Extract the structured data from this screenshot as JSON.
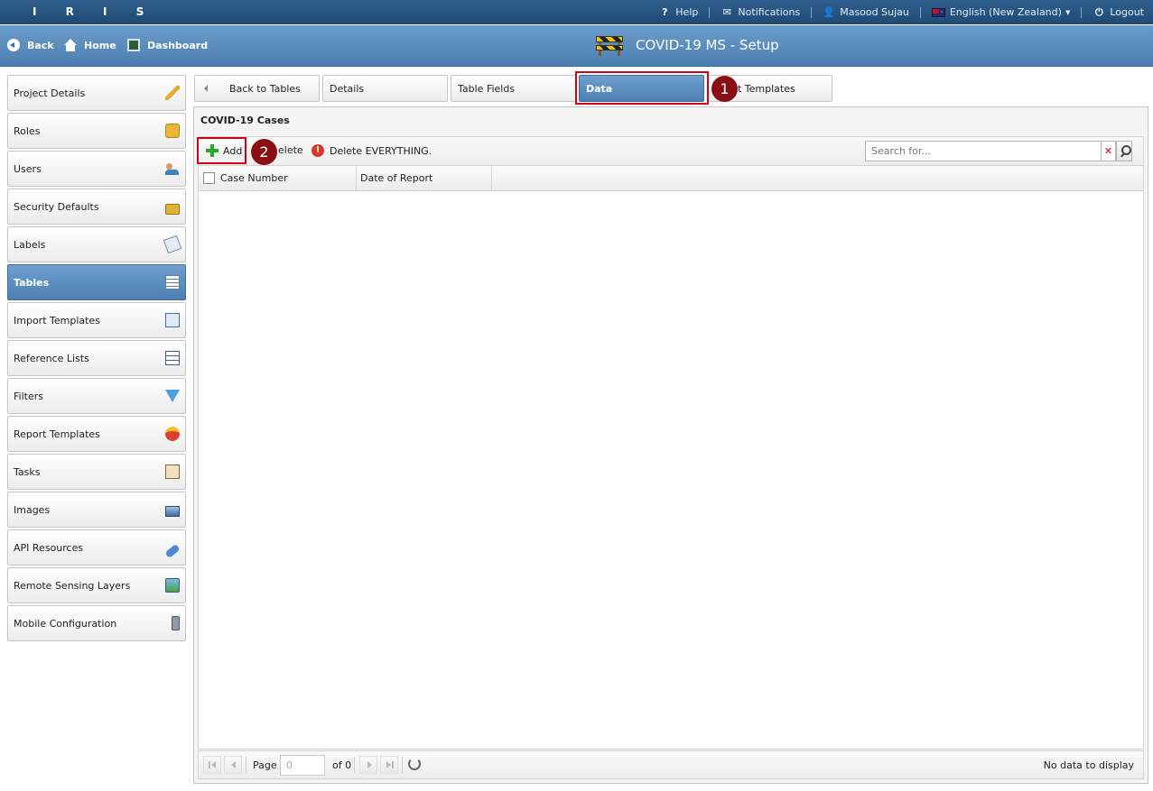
{
  "top": {
    "brand": "I R I S",
    "help": "Help",
    "notifications": "Notifications",
    "user": "Masood Sujau",
    "language": "English (New Zealand)",
    "logout": "Logout"
  },
  "nav": {
    "back": "Back",
    "home": "Home",
    "dashboard": "Dashboard",
    "title": "COVID-19 MS - Setup"
  },
  "sidebar": {
    "items": [
      {
        "label": "Project Details",
        "icon": "pencil-icon"
      },
      {
        "label": "Roles",
        "icon": "badge-icon"
      },
      {
        "label": "Users",
        "icon": "users-icon"
      },
      {
        "label": "Security Defaults",
        "icon": "lock-icon"
      },
      {
        "label": "Labels",
        "icon": "label-icon"
      },
      {
        "label": "Tables",
        "icon": "table-icon",
        "active": true
      },
      {
        "label": "Import Templates",
        "icon": "import-icon"
      },
      {
        "label": "Reference Lists",
        "icon": "reference-list-icon"
      },
      {
        "label": "Filters",
        "icon": "filter-icon"
      },
      {
        "label": "Report Templates",
        "icon": "report-icon"
      },
      {
        "label": "Tasks",
        "icon": "tasks-icon"
      },
      {
        "label": "Images",
        "icon": "image-icon"
      },
      {
        "label": "API Resources",
        "icon": "api-icon"
      },
      {
        "label": "Remote Sensing Layers",
        "icon": "layers-icon"
      },
      {
        "label": "Mobile Configuration",
        "icon": "mobile-icon"
      }
    ]
  },
  "tabs": {
    "back_to_tables": "Back to Tables",
    "details": "Details",
    "table_fields": "Table Fields",
    "data": "Data",
    "templates": "t Templates"
  },
  "markers": {
    "one": "1",
    "two": "2"
  },
  "panel": {
    "title": "COVID-19 Cases",
    "add": "Add",
    "delete": "elete",
    "delete_everything": "Delete EVERYTHING.",
    "search_placeholder": "Search for..."
  },
  "grid": {
    "columns": [
      "Case Number",
      "Date of Report"
    ]
  },
  "pager": {
    "page_label": "Page",
    "page_value": "0",
    "of_label": "of 0",
    "status": "No data to display"
  },
  "colors": {
    "topbar": "#1f4a73",
    "navbar": "#5a8dbf",
    "active": "#5a8dbf",
    "highlight": "#d0021b",
    "marker": "#8b0f12"
  }
}
